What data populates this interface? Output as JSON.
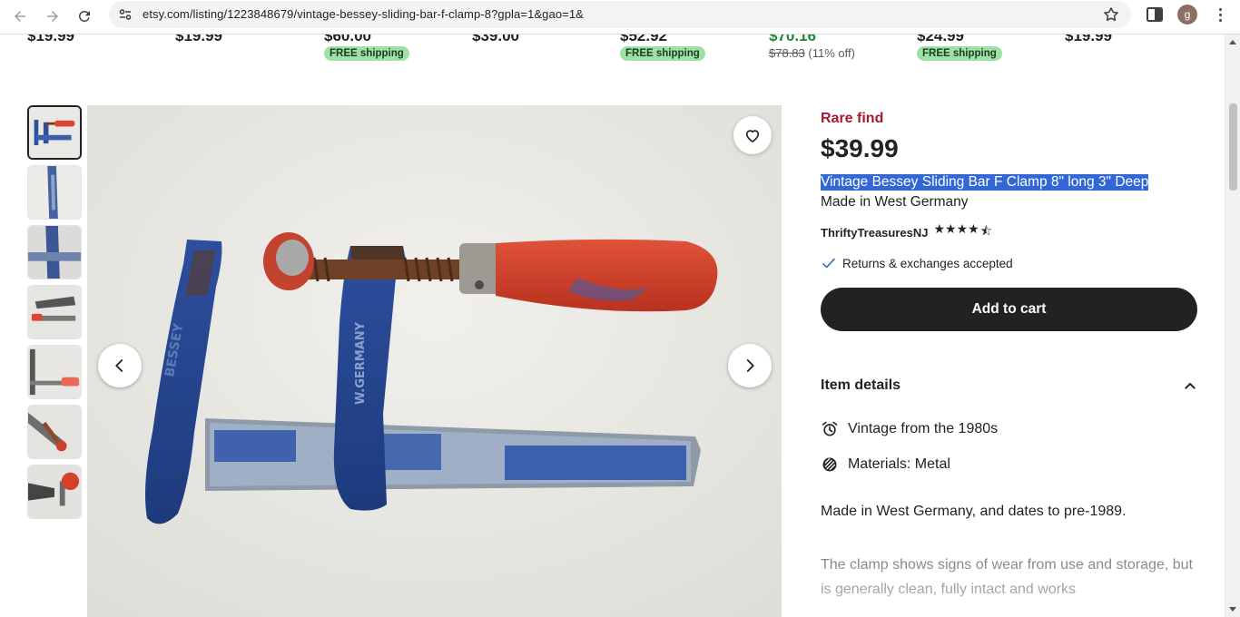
{
  "browser": {
    "url": "etsy.com/listing/1223848679/vintage-bessey-sliding-bar-f-clamp-8?gpla=1&gao=1&",
    "profile_initial": "g",
    "icons": [
      "back-arrow-icon",
      "forward-arrow-icon",
      "reload-icon",
      "site-info-icon",
      "bookmark-star-icon",
      "side-panel-icon",
      "kebab-menu-icon"
    ]
  },
  "recommendations": [
    {
      "price": "$19.99"
    },
    {
      "price": "$19.99"
    },
    {
      "price": "$60.00",
      "badge": "FREE shipping"
    },
    {
      "price": "$39.00"
    },
    {
      "price": "$52.92",
      "badge": "FREE shipping"
    },
    {
      "price": "$70.16",
      "old_price": "$78.83",
      "discount": "(11% off)"
    },
    {
      "price": "$24.99",
      "badge": "FREE shipping"
    },
    {
      "price": "$19.99"
    }
  ],
  "listing": {
    "rare_label": "Rare find",
    "price": "$39.99",
    "title_line1": "Vintage Bessey Sliding Bar F Clamp 8\" long 3\" Deep",
    "title_line2": "Made in West Germany",
    "shop_name": "ThriftyTreasuresNJ",
    "rating": 4.5,
    "rating_stars": "★★★★",
    "half_star": "⯪",
    "returns": "Returns & exchanges accepted",
    "add_to_cart": "Add to cart"
  },
  "item_details": {
    "header": "Item details",
    "rows": [
      {
        "icon": "alarm-clock-icon",
        "text": "Vintage from the 1980s"
      },
      {
        "icon": "materials-icon",
        "text": "Materials: Metal"
      }
    ],
    "description_1": "Made in West Germany, and dates to pre-1989.",
    "description_2": "The clamp shows signs of wear from use and storage, but is generally clean, fully intact and works"
  },
  "gallery": {
    "thumbnail_count": 7,
    "active_index": 0,
    "photo_text_jaw": "BESSEY",
    "photo_text_bar": "W.GERMANY"
  },
  "colors": {
    "accent_rare": "#a61a2e",
    "free_shipping_bg": "#9ee1a4",
    "sale_green": "#258635",
    "selection": "#3367d6",
    "button_dark": "#222222"
  }
}
